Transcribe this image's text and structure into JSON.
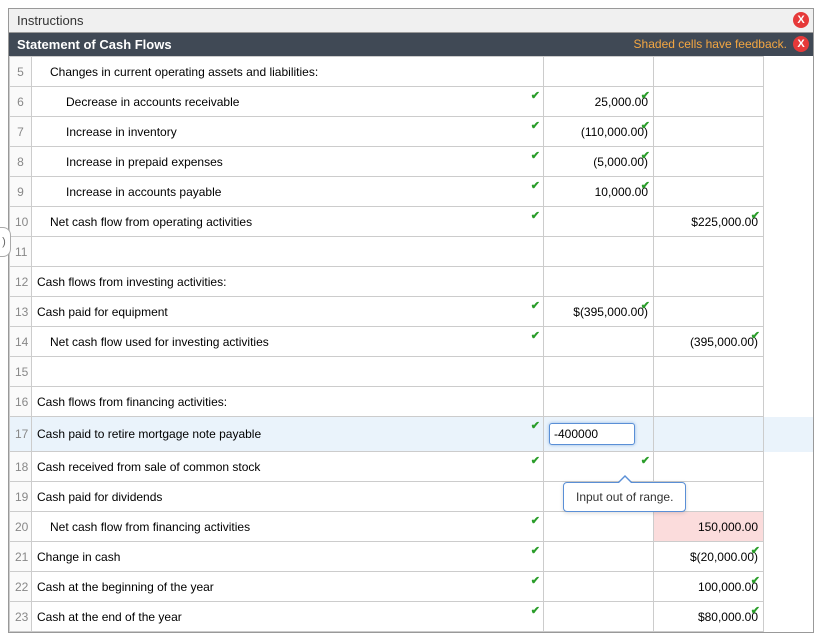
{
  "header": {
    "instructions_label": "Instructions",
    "title": "Statement of Cash Flows",
    "feedback_text": "Shaded cells have feedback.",
    "close_glyph": "X"
  },
  "tooltip": {
    "text": "Input out of range."
  },
  "rows": [
    {
      "num": "5",
      "desc": "Changes in current operating assets and liabilities:",
      "indent": 1,
      "desc_check": false,
      "v1": "",
      "v1_check": false,
      "v2": "",
      "v2_check": false
    },
    {
      "num": "6",
      "desc": "Decrease in accounts receivable",
      "indent": 2,
      "desc_check": true,
      "v1": "25,000.00",
      "v1_check": true,
      "v2": "",
      "v2_check": false
    },
    {
      "num": "7",
      "desc": "Increase in inventory",
      "indent": 2,
      "desc_check": true,
      "v1": "(110,000.00)",
      "v1_check": true,
      "v2": "",
      "v2_check": false
    },
    {
      "num": "8",
      "desc": "Increase in prepaid expenses",
      "indent": 2,
      "desc_check": true,
      "v1": "(5,000.00)",
      "v1_check": true,
      "v2": "",
      "v2_check": false
    },
    {
      "num": "9",
      "desc": "Increase in accounts payable",
      "indent": 2,
      "desc_check": true,
      "v1": "10,000.00",
      "v1_check": true,
      "v2": "",
      "v2_check": false
    },
    {
      "num": "10",
      "desc": "Net cash flow from operating activities",
      "indent": 1,
      "desc_check": true,
      "v1": "",
      "v1_check": false,
      "v2": "$225,000.00",
      "v2_check": true
    },
    {
      "num": "11",
      "desc": "",
      "indent": 0,
      "desc_check": false,
      "v1": "",
      "v1_check": false,
      "v2": "",
      "v2_check": false
    },
    {
      "num": "12",
      "desc": "Cash flows from investing activities:",
      "indent": 0,
      "desc_check": false,
      "v1": "",
      "v1_check": false,
      "v2": "",
      "v2_check": false
    },
    {
      "num": "13",
      "desc": "Cash paid for equipment",
      "indent": 0,
      "desc_check": true,
      "v1": "$(395,000.00)",
      "v1_check": true,
      "v2": "",
      "v2_check": false
    },
    {
      "num": "14",
      "desc": "Net cash flow used for investing activities",
      "indent": 1,
      "desc_check": true,
      "v1": "",
      "v1_check": false,
      "v2": "(395,000.00)",
      "v2_check": true
    },
    {
      "num": "15",
      "desc": "",
      "indent": 0,
      "desc_check": false,
      "v1": "",
      "v1_check": false,
      "v2": "",
      "v2_check": false
    },
    {
      "num": "16",
      "desc": "Cash flows from financing activities:",
      "indent": 0,
      "desc_check": false,
      "v1": "",
      "v1_check": false,
      "v2": "",
      "v2_check": false
    },
    {
      "num": "17",
      "desc": "Cash paid to retire mortgage note payable",
      "indent": 0,
      "desc_check": true,
      "v1_input": "-400000",
      "v1_check": false,
      "v2": "",
      "v2_check": false,
      "active": true
    },
    {
      "num": "18",
      "desc": "Cash received from sale of common stock",
      "indent": 0,
      "desc_check": true,
      "v1": "",
      "v1_check": true,
      "v2": "",
      "v2_check": false
    },
    {
      "num": "19",
      "desc": "Cash paid for dividends",
      "indent": 0,
      "desc_check": false,
      "v1": "",
      "v1_check": false,
      "v2": "",
      "v2_check": false
    },
    {
      "num": "20",
      "desc": "Net cash flow from financing activities",
      "indent": 1,
      "desc_check": true,
      "v1": "",
      "v1_check": false,
      "v2": "150,000.00",
      "v2_check": false,
      "v2_error": true
    },
    {
      "num": "21",
      "desc": "Change in cash",
      "indent": 0,
      "desc_check": true,
      "v1": "",
      "v1_check": false,
      "v2": "$(20,000.00)",
      "v2_check": true
    },
    {
      "num": "22",
      "desc": "Cash at the beginning of the year",
      "indent": 0,
      "desc_check": true,
      "v1": "",
      "v1_check": false,
      "v2": "100,000.00",
      "v2_check": true
    },
    {
      "num": "23",
      "desc": "Cash at the end of the year",
      "indent": 0,
      "desc_check": true,
      "v1": "",
      "v1_check": false,
      "v2": "$80,000.00",
      "v2_check": true
    }
  ]
}
